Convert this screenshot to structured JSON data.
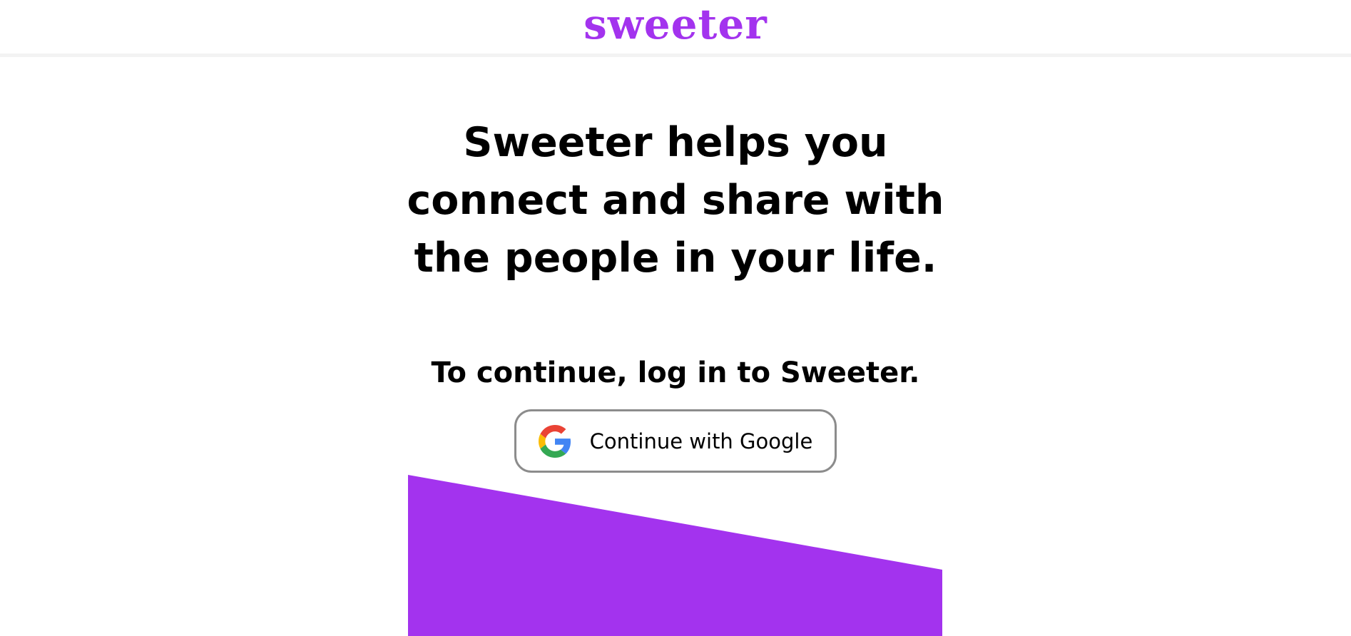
{
  "header": {
    "logo_text": "sweeter"
  },
  "hero": {
    "line1": "Sweeter helps you",
    "line2": "connect and share with",
    "line3": "the people in your life."
  },
  "login": {
    "prompt": "To continue, log in to Sweeter.",
    "google_button_label": "Continue with Google",
    "google_icon": "google-g-icon"
  },
  "colors": {
    "brand_purple": "#a333ee",
    "text": "#000000",
    "button_border": "#8c8c8c",
    "google_blue": "#4285F4",
    "google_red": "#EA4335",
    "google_yellow": "#FBBC05",
    "google_green": "#34A853"
  }
}
